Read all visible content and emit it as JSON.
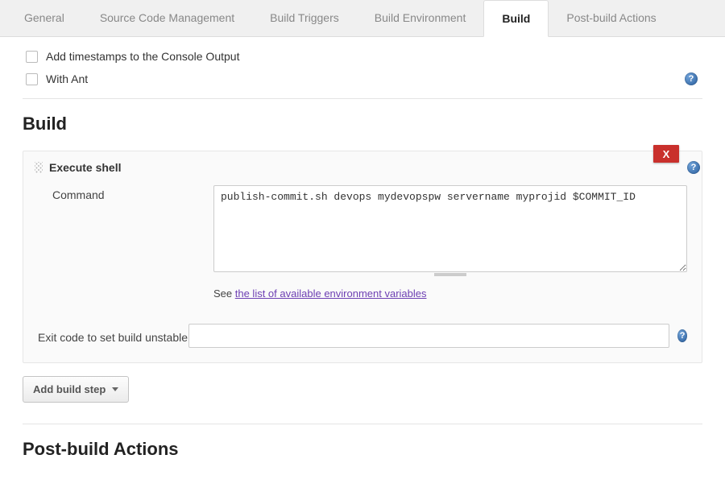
{
  "tabs": {
    "general": "General",
    "scm": "Source Code Management",
    "triggers": "Build Triggers",
    "env": "Build Environment",
    "build": "Build",
    "post": "Post-build Actions",
    "active": "build"
  },
  "checkboxes": {
    "timestamps": "Add timestamps to the Console Output",
    "withant": "With Ant"
  },
  "sections": {
    "build_heading": "Build",
    "postbuild_heading": "Post-build Actions"
  },
  "step": {
    "title": "Execute shell",
    "delete_label": "X",
    "command_label": "Command",
    "command_value": "publish-commit.sh devops mydevopspw servername myprojid $COMMIT_ID",
    "hint_prefix": "See ",
    "hint_link": "the list of available environment variables",
    "exit_label": "Exit code to set build unstable",
    "exit_value": ""
  },
  "buttons": {
    "add_step": "Add build step"
  },
  "icons": {
    "help_glyph": "?"
  }
}
